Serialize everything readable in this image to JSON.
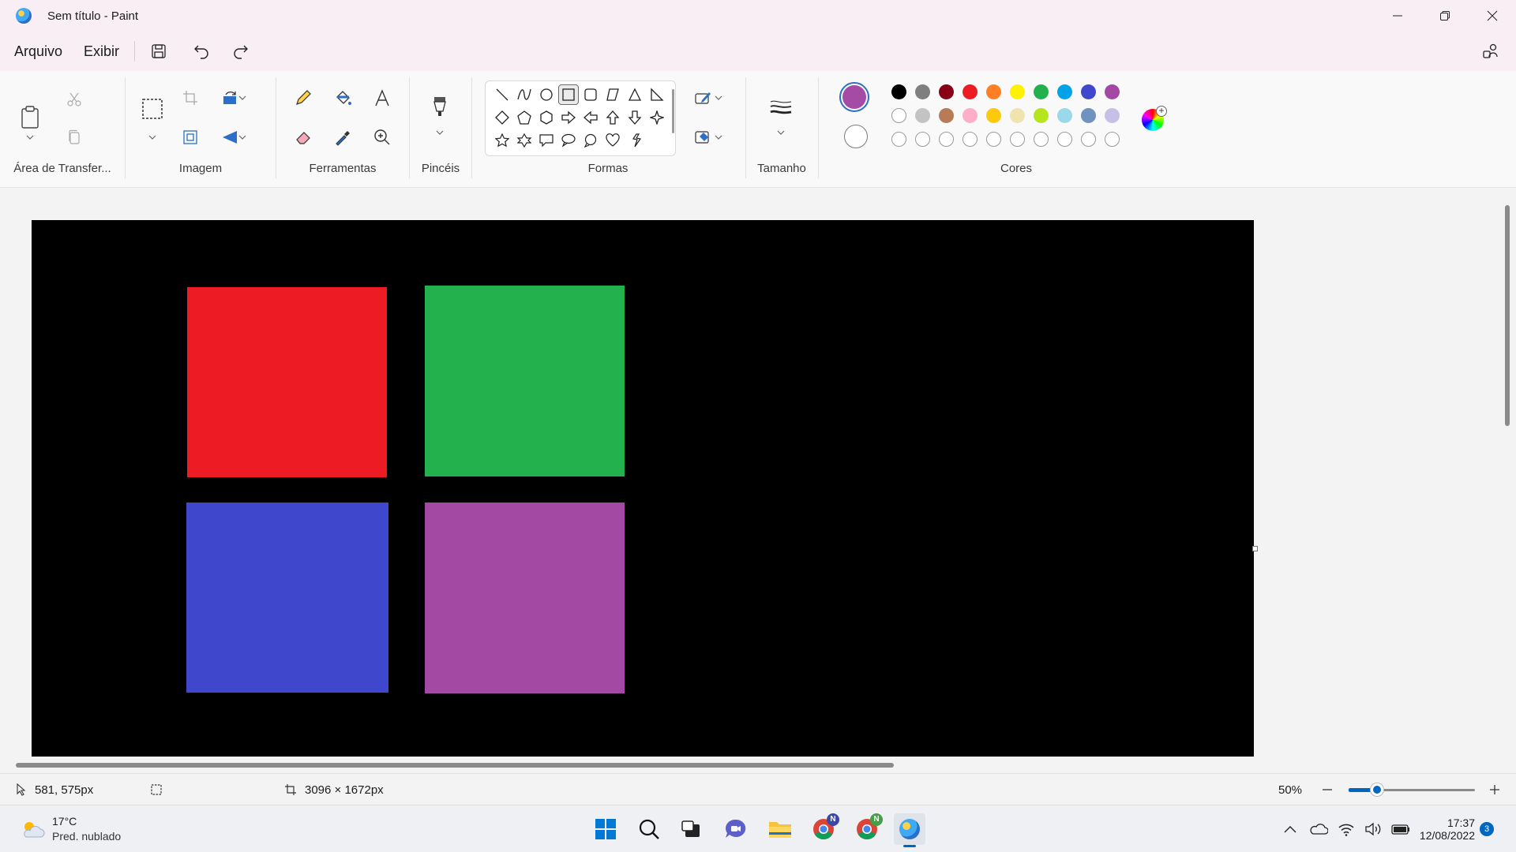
{
  "window": {
    "title": "Sem título - Paint"
  },
  "menu": {
    "file": "Arquivo",
    "view": "Exibir"
  },
  "ribbon": {
    "groups": {
      "clipboard": "Área de Transfer...",
      "image": "Imagem",
      "tools": "Ferramentas",
      "brushes": "Pincéis",
      "shapes": "Formas",
      "size": "Tamanho",
      "colors": "Cores"
    },
    "primary_color": "#a54ba5",
    "secondary_color": "#ffffff",
    "palette": [
      "#000000",
      "#7f7f7f",
      "#880015",
      "#ed1c24",
      "#ff7f27",
      "#fff200",
      "#22b14c",
      "#00a2e8",
      "#3f48cc",
      "#a349a4",
      "#ffffff",
      "#c3c3c3",
      "#b97a57",
      "#ffaec9",
      "#ffc90e",
      "#efe4b0",
      "#b5e61d",
      "#99d9ea",
      "#7092be",
      "#c8bfe7"
    ]
  },
  "canvas": {
    "background": "#000000",
    "rects": [
      {
        "name": "red-square",
        "color": "#ed1c24"
      },
      {
        "name": "green-square",
        "color": "#22b14c"
      },
      {
        "name": "blue-square",
        "color": "#3f48cc"
      },
      {
        "name": "purple-square",
        "color": "#a349a4"
      }
    ]
  },
  "status": {
    "cursor": "581, 575px",
    "canvas_size": "3096 × 1672px",
    "zoom": "50%"
  },
  "taskbar": {
    "weather_temp": "17°C",
    "weather_desc": "Pred. nublado",
    "time": "17:37",
    "date": "12/08/2022",
    "notifications": "3",
    "badge": "N"
  }
}
